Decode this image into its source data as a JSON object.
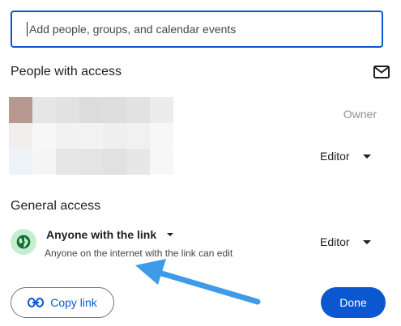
{
  "search": {
    "placeholder": "Add people, groups, and calendar events"
  },
  "people": {
    "title": "People with access",
    "rows": [
      {
        "role": "Owner"
      },
      {
        "role": "Editor"
      }
    ]
  },
  "general": {
    "title": "General access",
    "access_label": "Anyone with the link",
    "description": "Anyone on the internet with the link can edit",
    "role": "Editor"
  },
  "footer": {
    "copy_label": "Copy link",
    "done_label": "Done"
  },
  "colors": {
    "accent": "#0b57d0",
    "globe_bg": "#c4eed0",
    "globe_icon": "#146c2e",
    "annotation_arrow": "#3d9be9"
  },
  "icons": {
    "mail": "mail-icon",
    "globe": "globe-icon",
    "link": "link-icon",
    "dropdown": "caret-down-icon"
  }
}
